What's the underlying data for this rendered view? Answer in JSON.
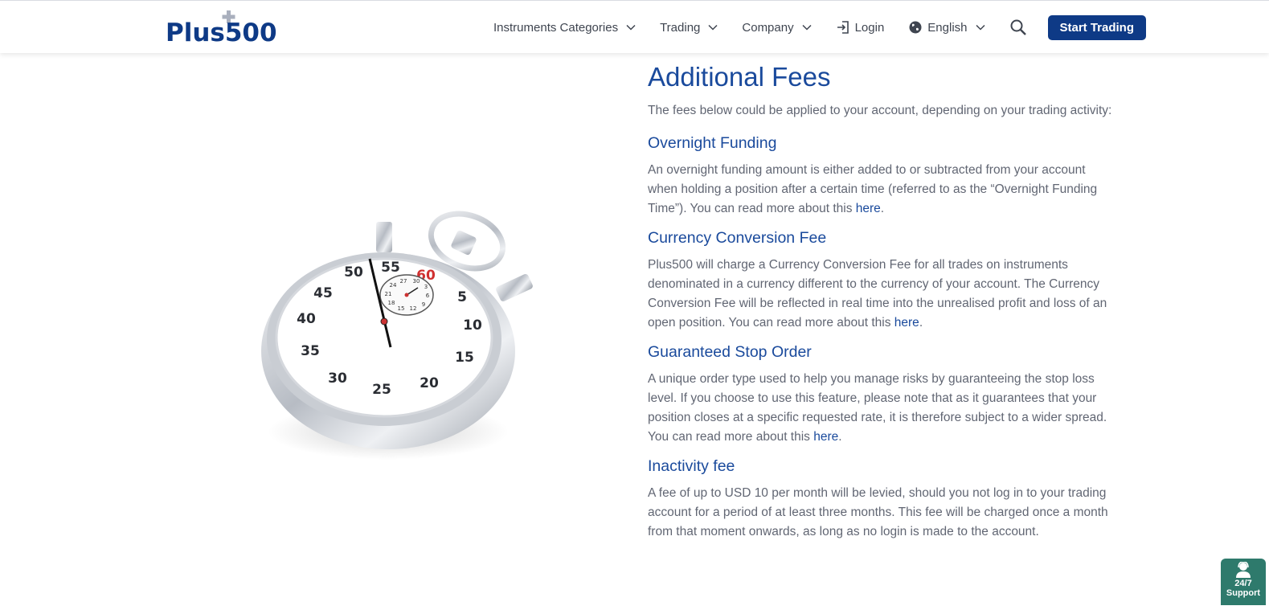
{
  "header": {
    "logo_text": "Plus500",
    "nav": {
      "instruments": "Instruments Categories",
      "trading": "Trading",
      "company": "Company",
      "login": "Login",
      "language": "English"
    },
    "cta": "Start Trading"
  },
  "colors": {
    "brand": "#0e3a86",
    "heading": "#1a4a9c",
    "support": "#2e7a6c"
  },
  "stopwatch": {
    "numbers": [
      "5",
      "10",
      "15",
      "20",
      "25",
      "30",
      "35",
      "40",
      "45",
      "50",
      "55",
      "60"
    ],
    "subdial_numbers": [
      "30",
      "3",
      "6",
      "9",
      "12",
      "15",
      "18",
      "21",
      "24",
      "27"
    ]
  },
  "main": {
    "title": "Additional Fees",
    "intro": "The fees below could be applied to your account, depending on your trading activity:",
    "link_text": "here",
    "sections": [
      {
        "heading": "Overnight Funding",
        "text": "An overnight funding amount is either added to or subtracted from your account when holding a position after a certain time (referred to as the “Overnight Funding Time”). You can read more about this ",
        "suffix": "."
      },
      {
        "heading": "Currency Conversion Fee",
        "text": "Plus500 will charge a Currency Conversion Fee for all trades on instruments denominated in a currency different to the currency of your account. The Currency Conversion Fee will be reflected in real time into the unrealised profit and loss of an open position. You can read more about this ",
        "suffix": "."
      },
      {
        "heading": "Guaranteed Stop Order",
        "text": "A unique order type used to help you manage risks by guaranteeing the stop loss level. If you choose to use this feature, please note that as it guarantees that your position closes at a specific requested rate, it is therefore subject to a wider spread. You can read more about this ",
        "suffix": "."
      },
      {
        "heading": "Inactivity fee",
        "text": "A fee of up to USD 10 per month will be levied, should you not log in to your trading account for a period of at least three months. This fee will be charged once a month from that moment onwards, as long as no login is made to the account."
      }
    ]
  },
  "support": {
    "line1": "24/7",
    "line2": "Support"
  }
}
